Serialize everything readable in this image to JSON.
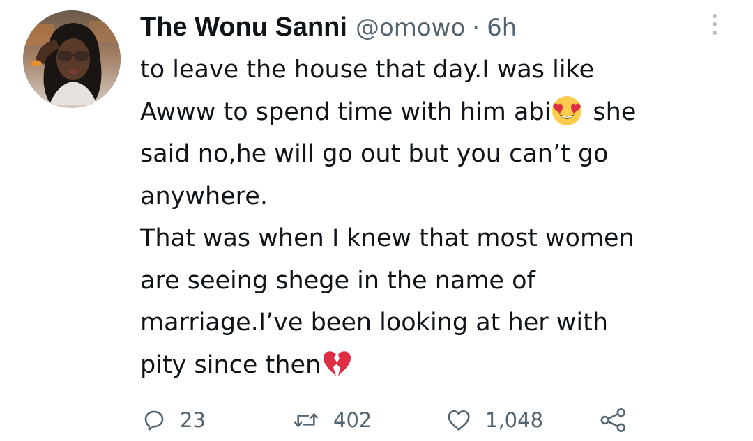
{
  "tweet": {
    "author_name": "The Wonu Sanni",
    "handle": "@omowo",
    "separator": "·",
    "time": "6h",
    "lines": [
      "to leave the house that day.I was like",
      "Awww to spend time with him abi",
      "she",
      "said no,he will go out but you can’t  go",
      "anywhere.",
      "That was when I knew that most women",
      "are seeing shege in the name of",
      "marriage.I’ve been looking at her with",
      "pity since then"
    ],
    "emojis": {
      "line2": "heart-eyes-emoji",
      "line9": "broken-heart-emoji"
    }
  },
  "actions": {
    "replies": "23",
    "retweets": "402",
    "likes": "1,048"
  },
  "icons": {
    "reply": "reply-icon",
    "retweet": "retweet-icon",
    "like": "like-icon",
    "share": "share-icon",
    "more": "more-options-icon"
  },
  "colors": {
    "text": "#0f1419",
    "secondary": "#536471",
    "heart_eyes_face": "#ffcc4d",
    "broken_heart": "#dd2e44"
  }
}
